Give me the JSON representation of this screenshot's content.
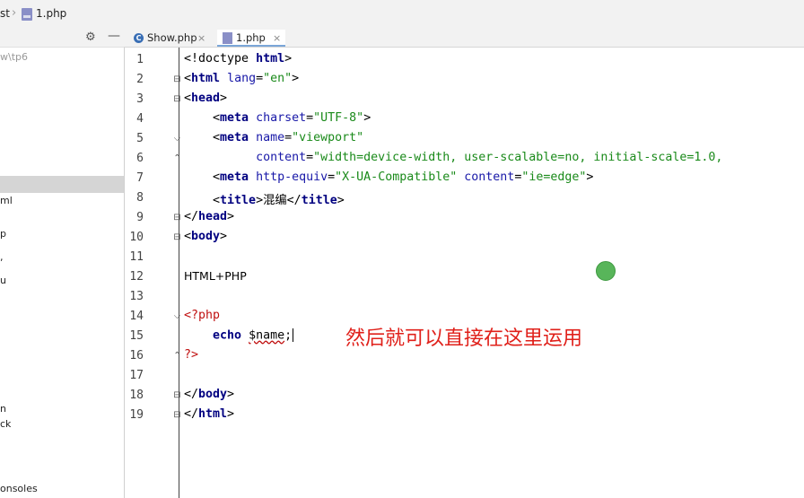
{
  "breadcrumb": {
    "project": "st",
    "file": "1.php"
  },
  "tabs": [
    {
      "label": "Show.php",
      "close": "×"
    },
    {
      "label": "1.php",
      "close": "×"
    }
  ],
  "toolbar": {
    "gear": "⚙",
    "minimize": "—"
  },
  "project_panel": {
    "path": "w\\tp6",
    "rows": [
      "ml",
      "p",
      ",",
      "u",
      "n",
      "ck",
      "onsoles"
    ]
  },
  "editor": {
    "line_numbers": [
      "1",
      "2",
      "3",
      "4",
      "5",
      "6",
      "7",
      "8",
      "9",
      "10",
      "11",
      "12",
      "13",
      "14",
      "15",
      "16",
      "17",
      "18",
      "19"
    ],
    "plain_text": "HTML+PHP",
    "echo_kw": "echo",
    "var": "$name",
    "semicolon": ";",
    "title_text": "混编"
  },
  "annotation": {
    "text": "然后就可以直接在这里运用",
    "color": "#e0201a"
  },
  "colors": {
    "tag": "#000000",
    "attribute": "#1818a8",
    "string": "#1a8a1a",
    "php": "#c01010"
  }
}
